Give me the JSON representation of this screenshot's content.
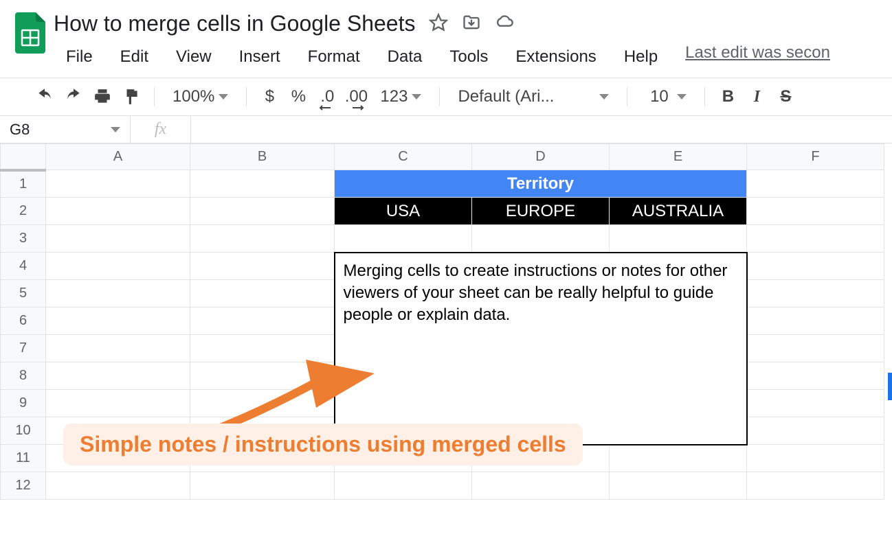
{
  "header": {
    "doc_title": "How to merge cells in Google Sheets",
    "last_edit": "Last edit was secon"
  },
  "menubar": {
    "items": [
      "File",
      "Edit",
      "View",
      "Insert",
      "Format",
      "Data",
      "Tools",
      "Extensions",
      "Help"
    ]
  },
  "toolbar": {
    "zoom": "100%",
    "currency": "$",
    "percent": "%",
    "dec_minus": ".0",
    "dec_plus": ".00",
    "format_more": "123",
    "font": "Default (Ari...",
    "font_size": "10"
  },
  "formula_bar": {
    "name_box": "G8",
    "fx": "fx"
  },
  "grid": {
    "columns": [
      "A",
      "B",
      "C",
      "D",
      "E",
      "F"
    ],
    "row_count": 12,
    "data": {
      "territory_header": "Territory",
      "regions": [
        "USA",
        "EUROPE",
        "AUSTRALIA"
      ],
      "note": "Merging cells to create instructions or notes for other viewers of your sheet can be really helpful to guide people or explain data."
    }
  },
  "annotation": {
    "label": "Simple notes / instructions using merged cells"
  }
}
